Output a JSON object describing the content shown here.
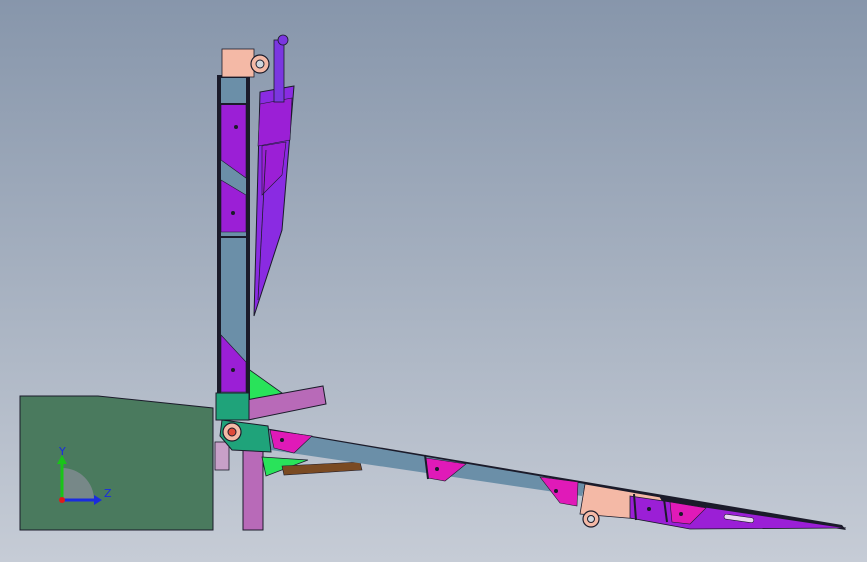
{
  "viewport": {
    "background_top": "#8796ab",
    "background_bottom": "#c6ccd6"
  },
  "triad": {
    "y_label": "Y",
    "z_label": "Z",
    "y_color": "#19c419",
    "z_color": "#1a2be0",
    "x_color": "#e01a1a"
  },
  "colors": {
    "base_block": "#4a7a5e",
    "mast_blue": "#6b8fa8",
    "truss_purple": "#9b1fd6",
    "truss_magenta": "#e01ab8",
    "cylinder_purple": "#8a2be2",
    "plate_pink": "#f4b9a6",
    "green_gusset": "#29e35a",
    "teal_hub": "#1fa37a",
    "brace_mauve": "#b86ab8",
    "edge": "#1b1b2a"
  }
}
